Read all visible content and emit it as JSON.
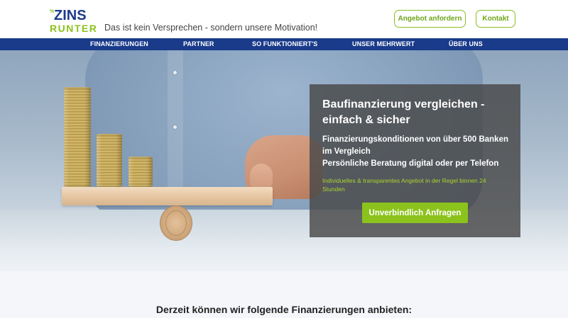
{
  "header": {
    "logo": {
      "line1": "ZINS",
      "line2": "RUNTER",
      "icon": "percent-logo-icon"
    },
    "tagline": "Das ist kein Versprechen - sondern unsere Motivation!",
    "offer_button": "Angebot anfordern",
    "contact_button": "Kontakt"
  },
  "nav": {
    "items": [
      {
        "label": "FINANZIERUNGEN"
      },
      {
        "label": "PARTNER"
      },
      {
        "label": "SO FUNKTIONIERT'S"
      },
      {
        "label": "UNSER MEHRWERT"
      },
      {
        "label": "ÜBER UNS"
      }
    ]
  },
  "hero": {
    "title": "Baufinanzierung vergleichen - einfach & sicher",
    "feature_1": "Finanzierungskonditionen von über 500 Banken im Vergleich",
    "feature_2": "Persönliche Beratung digital oder per Telefon",
    "note": "Individuelles & transparentes Angebot in der Regel binnen 24 Stunden",
    "cta": "Unverbindlich Anfragen"
  },
  "section": {
    "heading": "Derzeit können wir folgende Finanzierungen anbieten:"
  },
  "colors": {
    "brand_green": "#8cc21c",
    "nav_blue": "#1a3a8a",
    "logo_blue": "#1a3a8a"
  }
}
